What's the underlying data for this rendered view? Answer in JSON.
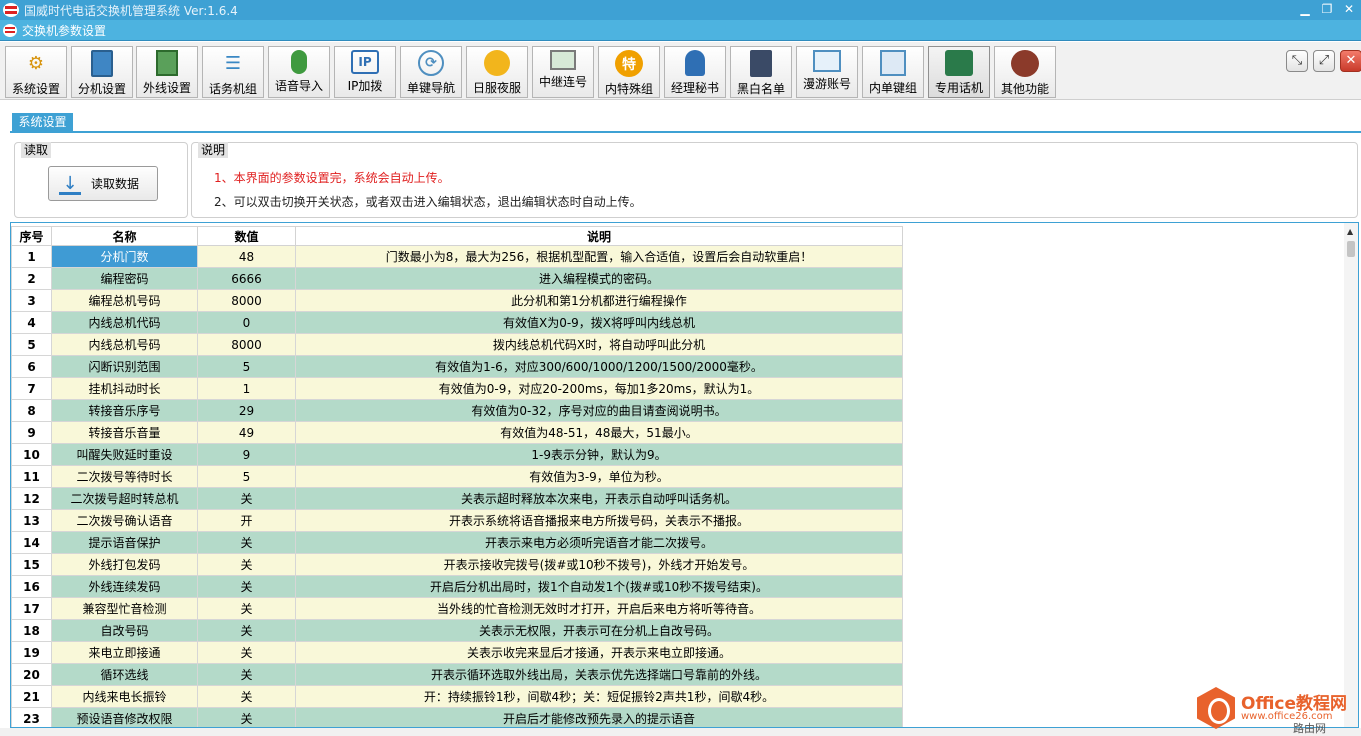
{
  "window": {
    "title": "国威时代电话交换机管理系统  Ver:1.6.4",
    "subtitle": "交换机参数设置"
  },
  "toolbar": {
    "buttons": [
      {
        "label": "系统设置",
        "icon": "gear-icon"
      },
      {
        "label": "分机设置",
        "icon": "calculator-icon"
      },
      {
        "label": "外线设置",
        "icon": "building-icon"
      },
      {
        "label": "话务机组",
        "icon": "group-icon"
      },
      {
        "label": "语音导入",
        "icon": "microphone-icon"
      },
      {
        "label": "IP加拨",
        "icon": "ip-icon"
      },
      {
        "label": "单键导航",
        "icon": "navigation-icon"
      },
      {
        "label": "日服夜服",
        "icon": "sun-moon-icon"
      },
      {
        "label": "中继连号",
        "icon": "relay-icon"
      },
      {
        "label": "内特殊组",
        "icon": "special-icon"
      },
      {
        "label": "经理秘书",
        "icon": "manager-icon"
      },
      {
        "label": "黑白名单",
        "icon": "notebook-icon"
      },
      {
        "label": "漫游账号",
        "icon": "roaming-icon"
      },
      {
        "label": "内单键组",
        "icon": "keys-icon"
      },
      {
        "label": "专用话机",
        "icon": "phone-icon"
      },
      {
        "label": "其他功能",
        "icon": "more-icon"
      }
    ],
    "special_glyph": "特",
    "ip_glyph": "IP"
  },
  "tab": {
    "label": "系统设置"
  },
  "read_group": {
    "legend": "读取",
    "button_label": "读取数据"
  },
  "note_group": {
    "legend": "说明",
    "line1": "1、本界面的参数设置完，系统会自动上传。",
    "line2": "2、可以双击切换开关状态，或者双击进入编辑状态，退出编辑状态时自动上传。"
  },
  "table": {
    "headers": [
      "序号",
      "名称",
      "数值",
      "说明"
    ],
    "rows": [
      [
        "1",
        "分机门数",
        "48",
        "门数最小为8，最大为256，根据机型配置，输入合适值，设置后会自动软重启！"
      ],
      [
        "2",
        "编程密码",
        "6666",
        "进入编程模式的密码。"
      ],
      [
        "3",
        "编程总机号码",
        "8000",
        "此分机和第1分机都进行编程操作"
      ],
      [
        "4",
        "内线总机代码",
        "0",
        "有效值X为0-9，拨X将呼叫内线总机"
      ],
      [
        "5",
        "内线总机号码",
        "8000",
        "拨内线总机代码X时，将自动呼叫此分机"
      ],
      [
        "6",
        "闪断识别范围",
        "5",
        "有效值为1-6，对应300/600/1000/1200/1500/2000毫秒。"
      ],
      [
        "7",
        "挂机抖动时长",
        "1",
        "有效值为0-9，对应20-200ms，每加1多20ms，默认为1。"
      ],
      [
        "8",
        "转接音乐序号",
        "29",
        "有效值为0-32，序号对应的曲目请查阅说明书。"
      ],
      [
        "9",
        "转接音乐音量",
        "49",
        "有效值为48-51，48最大，51最小。"
      ],
      [
        "10",
        "叫醒失败延时重设",
        "9",
        "1-9表示分钟，默认为9。"
      ],
      [
        "11",
        "二次拨号等待时长",
        "5",
        "有效值为3-9，单位为秒。"
      ],
      [
        "12",
        "二次拨号超时转总机",
        "关",
        "关表示超时释放本次来电，开表示自动呼叫话务机。"
      ],
      [
        "13",
        "二次拨号确认语音",
        "开",
        "开表示系统将语音播报来电方所拨号码，关表示不播报。"
      ],
      [
        "14",
        "提示语音保护",
        "关",
        "开表示来电方必须听完语音才能二次拨号。"
      ],
      [
        "15",
        "外线打包发码",
        "关",
        "开表示接收完拨号(拨#或10秒不拨号)，外线才开始发号。"
      ],
      [
        "16",
        "外线连续发码",
        "关",
        "开启后分机出局时，拨1个自动发1个(拨#或10秒不拨号结束)。"
      ],
      [
        "17",
        "兼容型忙音检测",
        "关",
        "当外线的忙音检测无效时才打开，开启后来电方将听等待音。"
      ],
      [
        "18",
        "自改号码",
        "关",
        "关表示无权限，开表示可在分机上自改号码。"
      ],
      [
        "19",
        "来电立即接通",
        "关",
        "关表示收完来显后才接通，开表示来电立即接通。"
      ],
      [
        "20",
        "循环选线",
        "关",
        "开表示循环选取外线出局，关表示优先选择端口号靠前的外线。"
      ],
      [
        "21",
        "内线来电长振铃",
        "关",
        "开：持续振铃1秒，间歇4秒；关：短促振铃2声共1秒，间歇4秒。"
      ],
      [
        "23",
        "预设语音修改权限",
        "关",
        "开启后才能修改预先录入的提示语音"
      ]
    ]
  },
  "watermark": {
    "brand": "Office教程网",
    "url": "www.office26.com",
    "site": "路由网"
  },
  "colors": {
    "title_blue": "#3ea1d4",
    "row_odd": "#f9f8d9",
    "row_even": "#b4dac9",
    "selection": "#3f9bd4",
    "note_red": "#e02020"
  }
}
